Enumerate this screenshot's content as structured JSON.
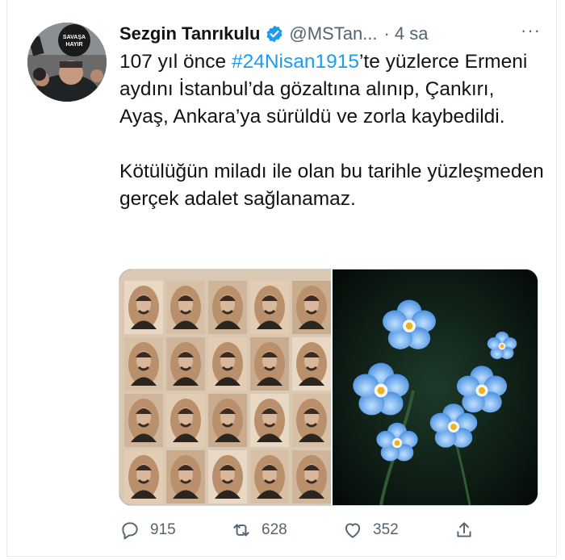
{
  "tweet": {
    "author_name": "Sezgin Tanrıkulu",
    "handle": "@MSTan...",
    "separator": "·",
    "time": "4 sa",
    "more": "···",
    "text_line_1_before": "107 yıl önce ",
    "hashtag": "#24Nisan1915",
    "text_line_1_after": "’te yüzlerce Ermeni aydını İstanbul’da gözaltına alınıp, Çankırı, Ayaş, Ankara’ya sürüldü ve zorla kaybedildi.",
    "text_paragraph_2": "Kötülüğün miladı ile olan bu tarihle yüzleşmeden gerçek adalet sağlanamaz.",
    "avatar_sign_text": "SAVAŞA HAYIR",
    "colors": {
      "link": "#1d9bf0",
      "verified": "#1d9bf0",
      "muted": "#536471"
    }
  },
  "media": {
    "left_image": "portrait-grid-image",
    "right_image": "forget-me-not-flowers-image"
  },
  "actions": {
    "replies": "915",
    "retweets": "628",
    "likes": "352",
    "icons": [
      "reply-icon",
      "retweet-icon",
      "like-icon",
      "share-icon"
    ]
  }
}
